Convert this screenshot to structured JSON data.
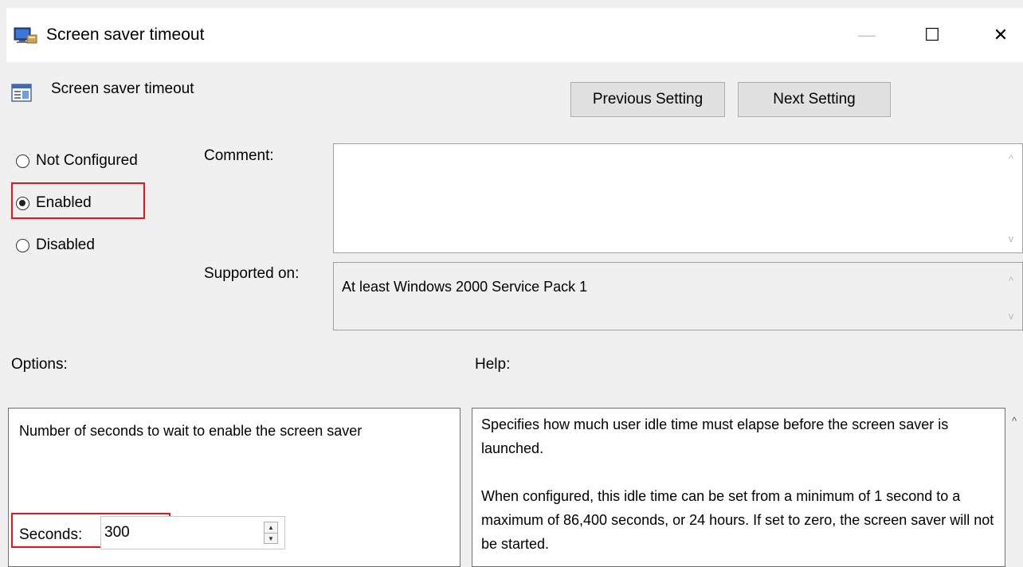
{
  "window": {
    "title": "Screen saver timeout",
    "controls": {
      "minimize": "—",
      "maximize": "☐",
      "close": "✕"
    }
  },
  "header": {
    "setting_name": "Screen saver timeout",
    "previous_button": "Previous Setting",
    "next_button": "Next Setting"
  },
  "state": {
    "options": [
      {
        "label": "Not Configured",
        "checked": false
      },
      {
        "label": "Enabled",
        "checked": true
      },
      {
        "label": "Disabled",
        "checked": false
      }
    ]
  },
  "comment": {
    "label": "Comment:",
    "value": ""
  },
  "supported": {
    "label": "Supported on:",
    "value": "At least Windows 2000 Service Pack 1"
  },
  "options_section": {
    "label": "Options:",
    "description": "Number of seconds to wait to enable the screen saver",
    "seconds_label": "Seconds:",
    "seconds_value": "300"
  },
  "help_section": {
    "label": "Help:",
    "paragraphs": [
      "Specifies how much user idle time must elapse before the screen saver is launched.",
      "When configured, this idle time can be set from a minimum of 1 second to a maximum of 86,400 seconds, or 24 hours. If set to zero, the screen saver will not be started."
    ]
  },
  "icons": {
    "window_icon": "policy-monitor-icon",
    "setting_icon": "policy-setting-icon",
    "scroll_up": "^",
    "scroll_down": "v"
  },
  "colors": {
    "highlight": "#e8141c",
    "background": "#f0f0f0",
    "button_face": "#e1e1e1"
  }
}
